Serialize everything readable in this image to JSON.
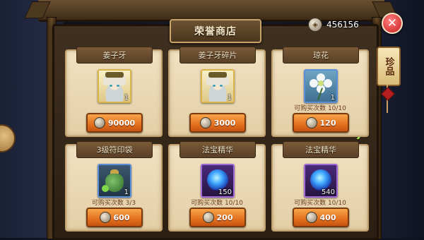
{
  "shop": {
    "title": "荣誉商店"
  },
  "currency": {
    "amount": "456156",
    "icon": "honor-coin-icon"
  },
  "side_tab": {
    "label": "珍品"
  },
  "items": [
    {
      "name": "姜子牙",
      "qty": "1",
      "limit": "",
      "price": "90000",
      "icon": "character-portrait"
    },
    {
      "name": "姜子牙碎片",
      "qty": "1",
      "limit": "",
      "price": "3000",
      "icon": "character-fragment"
    },
    {
      "name": "琼花",
      "qty": "1",
      "limit": "可购买次数 10/10",
      "price": "120",
      "icon": "white-flower"
    },
    {
      "name": "3级符印袋",
      "qty": "1",
      "limit": "可购买次数 3/3",
      "price": "600",
      "icon": "green-bag"
    },
    {
      "name": "法宝精华",
      "qty": "150",
      "limit": "可购买次数 10/10",
      "price": "200",
      "icon": "blue-essence"
    },
    {
      "name": "法宝精华",
      "qty": "540",
      "limit": "可购买次数 10/10",
      "price": "400",
      "icon": "purple-essence"
    }
  ]
}
